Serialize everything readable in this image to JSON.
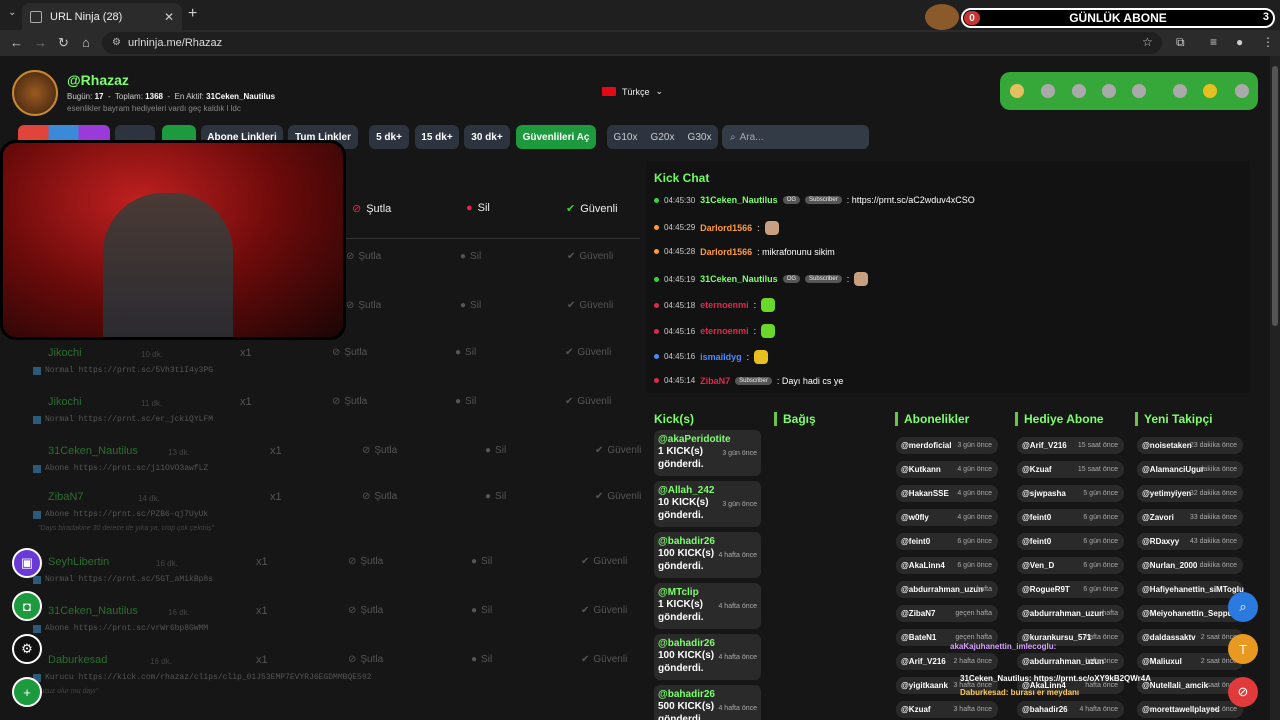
{
  "browser": {
    "tab_title": "URL Ninja (28)",
    "url": "urlninja.me/Rhazaz"
  },
  "abone_banner": {
    "label": "GÜNLÜK ABONE",
    "left_count": "0",
    "right_count": "3"
  },
  "profile": {
    "name": "@Rhazaz",
    "today_label": "Bugün:",
    "today_value": "17",
    "total_label": "Toplam:",
    "total_value": "1368",
    "last_active_label": "En Aktif:",
    "last_active_value": "31Ceken_Nautilus",
    "bio": "esenlikler bayram hediyeleri vardı geç kaldık l ldc"
  },
  "language": "Türkçe",
  "toolbar": {
    "btn_abone": "Abone Linkleri",
    "btn_tum": "Tum Linkler",
    "btn_5dk": "5 dk+",
    "btn_15dk": "15 dk+",
    "btn_30dk": "30 dk+",
    "btn_guvenli": "Güvenlileri Aç",
    "g10": "G10x",
    "g20": "G20x",
    "g30": "G30x",
    "search_placeholder": "Ara..."
  },
  "table_header": {
    "sutla": "Şutla",
    "sil": "Sil",
    "guvenli": "Güvenli"
  },
  "rows": [
    {
      "name": "Jikochi",
      "time": "10 dk.",
      "x": "x1",
      "sutla": "Şutla",
      "sil": "Sil",
      "guvenli": "Güvenli",
      "sub": "Normal https://prnt.sc/5Vh3tiI4y3PG",
      "note": ""
    },
    {
      "name": "Jikochi",
      "time": "11 dk.",
      "x": "x1",
      "sutla": "Şutla",
      "sil": "Sil",
      "guvenli": "Güvenli",
      "sub": "Normal https://prnt.sc/er_jckiQYLFM",
      "note": ""
    },
    {
      "name": "31Ceken_Nautilus",
      "time": "13 dk.",
      "x": "x1",
      "sutla": "Şutla",
      "sil": "Sil",
      "guvenli": "Güvenli",
      "sub": "Abone https://prnt.sc/j11OVO3awfLZ",
      "note": ""
    },
    {
      "name": "ZibaN7",
      "time": "14 dk.",
      "x": "x1",
      "sutla": "Şutla",
      "sil": "Sil",
      "guvenli": "Güvenli",
      "sub": "Abone https://prnt.sc/PZB6-qj7UyUk",
      "note": "\"Days biradakine 30 derece de yıka ya, crop çok çekmiş\""
    },
    {
      "name": "SeyhLibertin",
      "time": "16 dk.",
      "x": "x1",
      "sutla": "Şutla",
      "sil": "Sil",
      "guvenli": "Güvenli",
      "sub": "Normal https://prnt.sc/5GT_aMikBp8s",
      "note": ""
    },
    {
      "name": "31Ceken_Nautilus",
      "time": "16 dk.",
      "x": "x1",
      "sutla": "Şutla",
      "sil": "Sil",
      "guvenli": "Güvenli",
      "sub": "Abone https://prnt.sc/vrWr6bp8GWMM",
      "note": ""
    },
    {
      "name": "Daburkesad",
      "time": "16 dk.",
      "x": "x1",
      "sutla": "Şutla",
      "sil": "Sil",
      "guvenli": "Güvenli",
      "sub": "Kurucu https://kick.com/rhazaz/clips/clip_01J53EMP7EVYRJ6EGDMMBQE592",
      "note": "\"ucuz olur mu dayı\""
    }
  ],
  "kick_chat": {
    "title": "Kick Chat",
    "messages": [
      {
        "time": "04:45:30",
        "user": "31Ceken_Nautilus",
        "badges": [
          "OG",
          "Subscriber"
        ],
        "text": ": https://prnt.sc/aC2wduv4xCSO",
        "color": "#7dff6d",
        "dot": "#3ad23a"
      },
      {
        "time": "04:45:29",
        "user": "Darlord1566",
        "badges": [],
        "text": ":",
        "color": "#ff9a3c",
        "dot": "#ff9a3c"
      },
      {
        "time": "04:45:28",
        "user": "Darlord1566",
        "badges": [],
        "text": ": mikrafonunu sikim",
        "color": "#ff9a3c",
        "dot": "#ff9a3c"
      },
      {
        "time": "04:45:19",
        "user": "31Ceken_Nautilus",
        "badges": [
          "OG",
          "Subscriber"
        ],
        "text": ":",
        "color": "#7dff6d",
        "dot": "#3ad23a"
      },
      {
        "time": "04:45:18",
        "user": "eternoenmi",
        "badges": [],
        "text": ":",
        "color": "#e0284a",
        "dot": "#e0284a"
      },
      {
        "time": "04:45:16",
        "user": "eternoenmi",
        "badges": [],
        "text": ":",
        "color": "#e0284a",
        "dot": "#e0284a"
      },
      {
        "time": "04:45:16",
        "user": "ismaildyg",
        "badges": [],
        "text": ":",
        "color": "#4a8aff",
        "dot": "#4a8aff"
      },
      {
        "time": "04:45:14",
        "user": "ZibaN7",
        "badges": [
          "Subscriber"
        ],
        "text": ": Dayı hadi cs ye",
        "color": "#e0284a",
        "dot": "#e0284a"
      }
    ]
  },
  "sections": {
    "kicks": "Kick(s)",
    "bagis": "Bağış",
    "abonelikler": "Abonelikler",
    "hediye": "Hediye Abone",
    "takipci": "Yeni Takipçi"
  },
  "kick_cards": [
    {
      "name": "@akaPeridotite",
      "amount": "1 KICK(s) gönderdi.",
      "time": "3 gün önce"
    },
    {
      "name": "@Allah_242",
      "amount": "10 KICK(s) gönderdi.",
      "time": "3 gün önce"
    },
    {
      "name": "@bahadir26",
      "amount": "100 KICK(s) gönderdi.",
      "time": "4 hafta önce"
    },
    {
      "name": "@MTclip",
      "amount": "1 KICK(s) gönderdi.",
      "time": "4 hafta önce"
    },
    {
      "name": "@bahadir26",
      "amount": "100 KICK(s) gönderdi.",
      "time": "4 hafta önce"
    },
    {
      "name": "@bahadir26",
      "amount": "500 KICK(s) gönderdi.",
      "time": "4 hafta önce"
    }
  ],
  "abonelikler": [
    {
      "n": "@merdoficial",
      "t": "3 gün önce"
    },
    {
      "n": "@Kutkann",
      "t": "4 gün önce"
    },
    {
      "n": "@HakanSSE",
      "t": "4 gün önce"
    },
    {
      "n": "@w0fly",
      "t": "4 gün önce"
    },
    {
      "n": "@feint0",
      "t": "6 gün önce"
    },
    {
      "n": "@AkaLinn4",
      "t": "6 gün önce"
    },
    {
      "n": "@abdurrahman_uzun",
      "t": "hafta"
    },
    {
      "n": "@ZibaN7",
      "t": "geçen hafta"
    },
    {
      "n": "@BateN1",
      "t": "geçen hafta"
    },
    {
      "n": "@Arif_V216",
      "t": "2 hafta önce"
    },
    {
      "n": "@yigitkaank",
      "t": "3 hafta önce"
    },
    {
      "n": "@Kzuaf",
      "t": "3 hafta önce"
    }
  ],
  "hediye": [
    {
      "n": "@Arif_V216",
      "t": "15 saat önce"
    },
    {
      "n": "@Kzuaf",
      "t": "15 saat önce"
    },
    {
      "n": "@sjwpasha",
      "t": "5 gün önce"
    },
    {
      "n": "@feint0",
      "t": "6 gün önce"
    },
    {
      "n": "@feint0",
      "t": "6 gün önce"
    },
    {
      "n": "@Ven_D",
      "t": "6 gün önce"
    },
    {
      "n": "@RogueR9T",
      "t": "6 gün önce"
    },
    {
      "n": "@abdurrahman_uzun",
      "t": "hafta"
    },
    {
      "n": "@kurankursu_571",
      "t": "hafta önce"
    },
    {
      "n": "@abdurrahman_uzun",
      "t": "hafta önce"
    },
    {
      "n": "@AkaLinn4",
      "t": "hafta önce"
    },
    {
      "n": "@bahadir26",
      "t": "4 hafta önce"
    }
  ],
  "takipci": [
    {
      "n": "@noisetaken",
      "t": "23 dakika önce"
    },
    {
      "n": "@AlamanciUgur",
      "t": "dakika önce"
    },
    {
      "n": "@yetimyiyen",
      "t": "32 dakika önce"
    },
    {
      "n": "@Zavori",
      "t": "33 dakika önce"
    },
    {
      "n": "@RDaxyy",
      "t": "43 dakika önce"
    },
    {
      "n": "@Nurlan_2000",
      "t": "dakika önce"
    },
    {
      "n": "@Hafiyehanettin_siMTogIu",
      "t": ""
    },
    {
      "n": "@Meiyohanettin_Seppuku",
      "t": ""
    },
    {
      "n": "@daldassaktv",
      "t": "2 saat önce"
    },
    {
      "n": "@Maliuxul",
      "t": "2 saat önce"
    },
    {
      "n": "@Nutellali_amcik",
      "t": "saat önce"
    },
    {
      "n": "@morettawellplayed",
      "t": "saat önce"
    }
  ],
  "overlay": {
    "m1": "akaKajuhanettin_imlecoglu:",
    "m2": "31Ceken_Nautilus: https://prnt.sc/oXY9kB2QWr4A",
    "m3": "Daburkesad: burası er meydanı"
  }
}
